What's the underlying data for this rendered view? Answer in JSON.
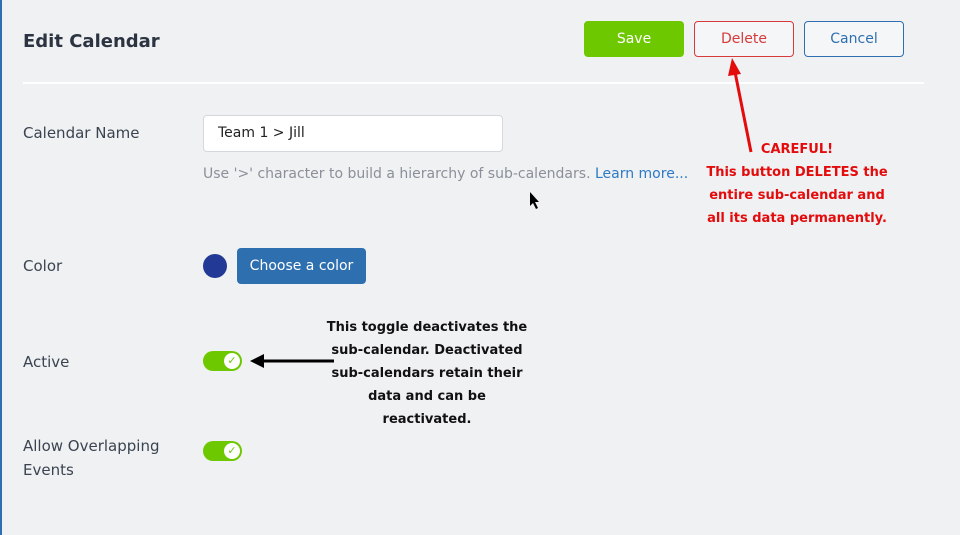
{
  "header": {
    "title": "Edit Calendar",
    "save": "Save",
    "delete": "Delete",
    "cancel": "Cancel"
  },
  "form": {
    "name_label": "Calendar Name",
    "name_value": "Team 1 > Jill",
    "hint": "Use '>' character to build a hierarchy of sub-calendars.",
    "learn_more": "Learn more...",
    "color_label": "Color",
    "color_value": "#223a96",
    "choose_color": "Choose a color",
    "active_label": "Active",
    "active_on": true,
    "overlap_label": "Allow Overlapping Events",
    "overlap_on": true
  },
  "annotations": {
    "toggle_note": "This toggle deactivates the sub-calendar. Deactivated sub-calendars retain their data and can be reactivated.",
    "careful": "CAREFUL!",
    "delete_note": "This button DELETES the entire sub-calendar and all its data permanently."
  },
  "colors": {
    "save": "#6dc800",
    "delete": "#d63a3a",
    "accent": "#2e6fb0",
    "warning": "#e30b0b"
  }
}
